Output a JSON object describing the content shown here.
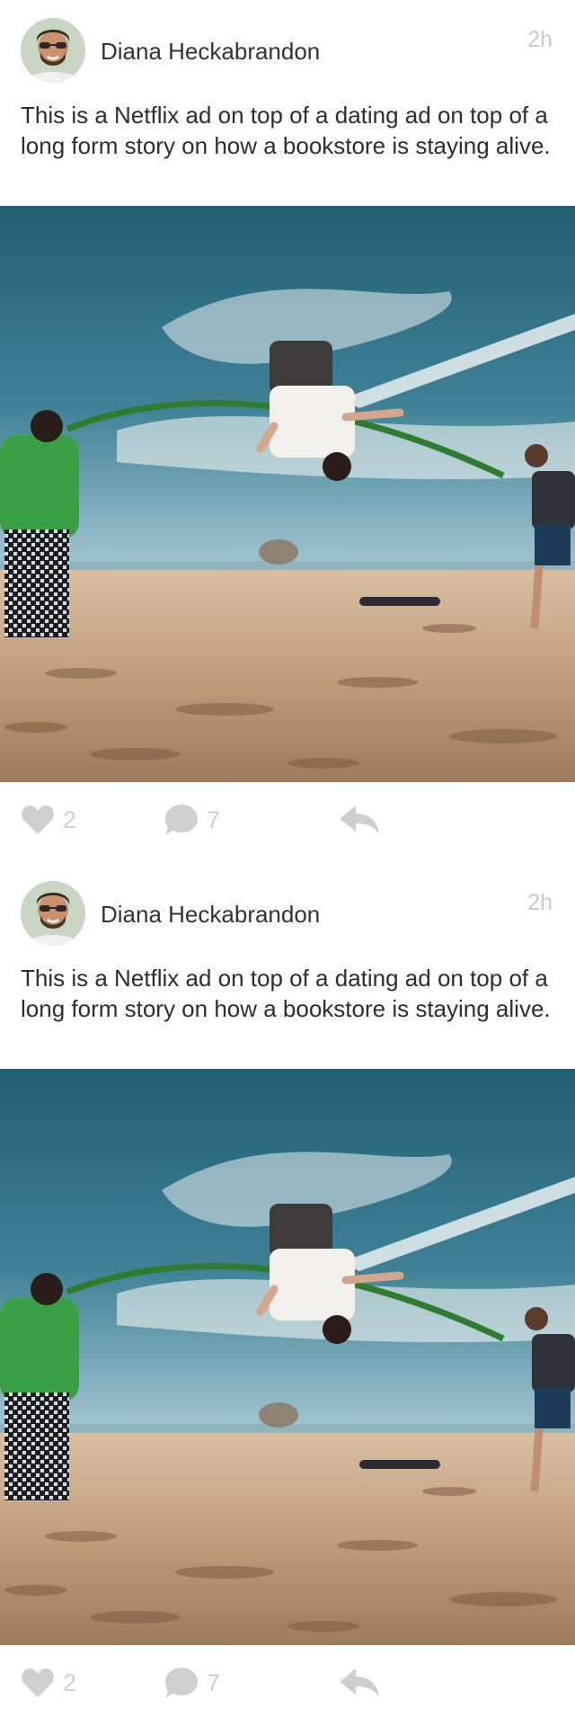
{
  "colors": {
    "icon_gray": "#cfcfcf",
    "timestamp_gray": "#c9c9c9",
    "text_dark": "#2e2e2e",
    "author_text": "#333333"
  },
  "posts": [
    {
      "author": "Diana Heckabrandon",
      "time": "2h",
      "text": "This is a Netflix ad on top of a dating ad on top of a long form story on how a bookstore is staying alive.",
      "likes": "2",
      "comments": "7",
      "icons": {
        "like": "heart-icon",
        "comment": "comment-bubble-icon",
        "reply": "reply-arrow-icon"
      }
    },
    {
      "author": "Diana Heckabrandon",
      "time": "2h",
      "text": "This is a Netflix ad on top of a dating ad on top of a long form story on how a bookstore is staying alive.",
      "likes": "2",
      "comments": "7",
      "icons": {
        "like": "heart-icon",
        "comment": "comment-bubble-icon",
        "reply": "reply-arrow-icon"
      }
    }
  ]
}
